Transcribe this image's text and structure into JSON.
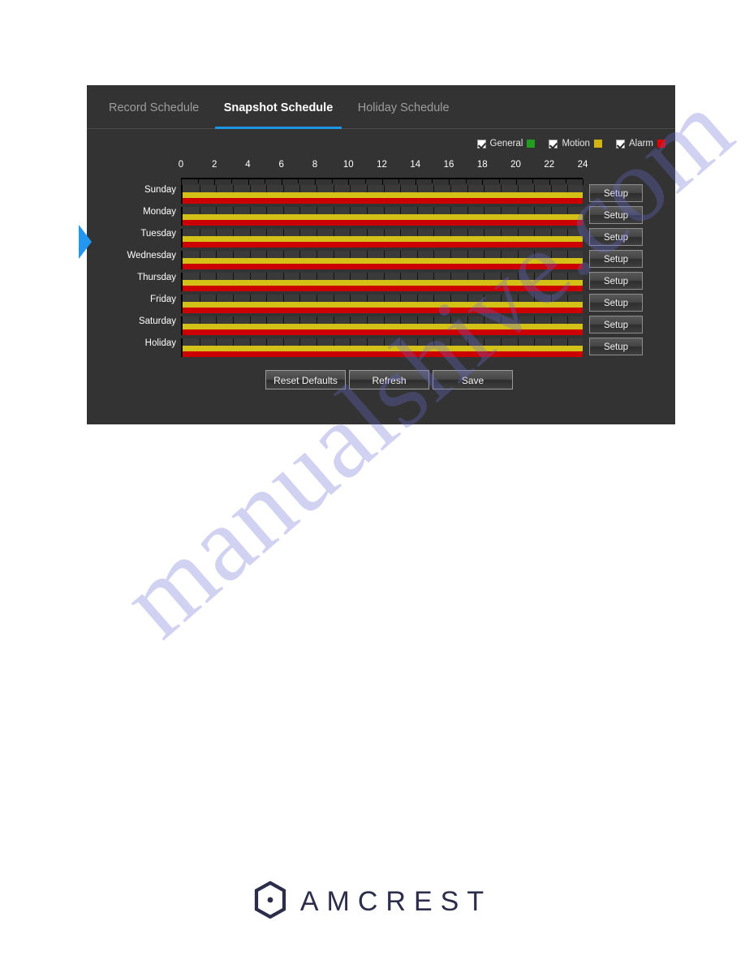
{
  "tabs": [
    {
      "label": "Record Schedule",
      "active": false
    },
    {
      "label": "Snapshot Schedule",
      "active": true
    },
    {
      "label": "Holiday Schedule",
      "active": false
    }
  ],
  "legend": {
    "items": [
      {
        "label": "General",
        "color": "#1f9e1f",
        "checked": true
      },
      {
        "label": "Motion",
        "color": "#d4b316",
        "checked": true
      },
      {
        "label": "Alarm",
        "color": "#e00000",
        "checked": true
      }
    ]
  },
  "axis": {
    "ticks": [
      "0",
      "2",
      "4",
      "6",
      "8",
      "10",
      "12",
      "14",
      "16",
      "18",
      "20",
      "22",
      "24"
    ],
    "min": 0,
    "max": 24,
    "tick_step_hours": 1,
    "label_step_hours": 2
  },
  "schedule": {
    "setup_label": "Setup",
    "rows": [
      {
        "day": "Sunday",
        "segments": [
          {
            "type": "Motion",
            "start": 0,
            "end": 24
          },
          {
            "type": "Alarm",
            "start": 0,
            "end": 24
          }
        ]
      },
      {
        "day": "Monday",
        "segments": [
          {
            "type": "Motion",
            "start": 0,
            "end": 24
          },
          {
            "type": "Alarm",
            "start": 0,
            "end": 24
          }
        ]
      },
      {
        "day": "Tuesday",
        "segments": [
          {
            "type": "Motion",
            "start": 0,
            "end": 24
          },
          {
            "type": "Alarm",
            "start": 0,
            "end": 24
          }
        ]
      },
      {
        "day": "Wednesday",
        "segments": [
          {
            "type": "Motion",
            "start": 0,
            "end": 24
          },
          {
            "type": "Alarm",
            "start": 0,
            "end": 24
          }
        ]
      },
      {
        "day": "Thursday",
        "segments": [
          {
            "type": "Motion",
            "start": 0,
            "end": 24
          },
          {
            "type": "Alarm",
            "start": 0,
            "end": 24
          }
        ]
      },
      {
        "day": "Friday",
        "segments": [
          {
            "type": "Motion",
            "start": 0,
            "end": 24
          },
          {
            "type": "Alarm",
            "start": 0,
            "end": 24
          }
        ]
      },
      {
        "day": "Saturday",
        "segments": [
          {
            "type": "Motion",
            "start": 0,
            "end": 24
          },
          {
            "type": "Alarm",
            "start": 0,
            "end": 24
          }
        ]
      },
      {
        "day": "Holiday",
        "segments": [
          {
            "type": "Motion",
            "start": 0,
            "end": 24
          },
          {
            "type": "Alarm",
            "start": 0,
            "end": 24
          }
        ]
      }
    ]
  },
  "actions": [
    {
      "label": "Reset Defaults"
    },
    {
      "label": "Refresh"
    },
    {
      "label": "Save"
    }
  ],
  "footer": {
    "brand": "AMCREST",
    "logo_icon": "amcrest-hexagon-icon"
  },
  "watermark": {
    "text": "manualshive.com"
  },
  "colors": {
    "panel_bg": "#333333",
    "tab_active_underline": "#1f95e6",
    "general": "#1f9e1f",
    "motion": "#d4c118",
    "alarm": "#cc0000",
    "track": "#3a3a3a",
    "marker": "#2196f3"
  }
}
